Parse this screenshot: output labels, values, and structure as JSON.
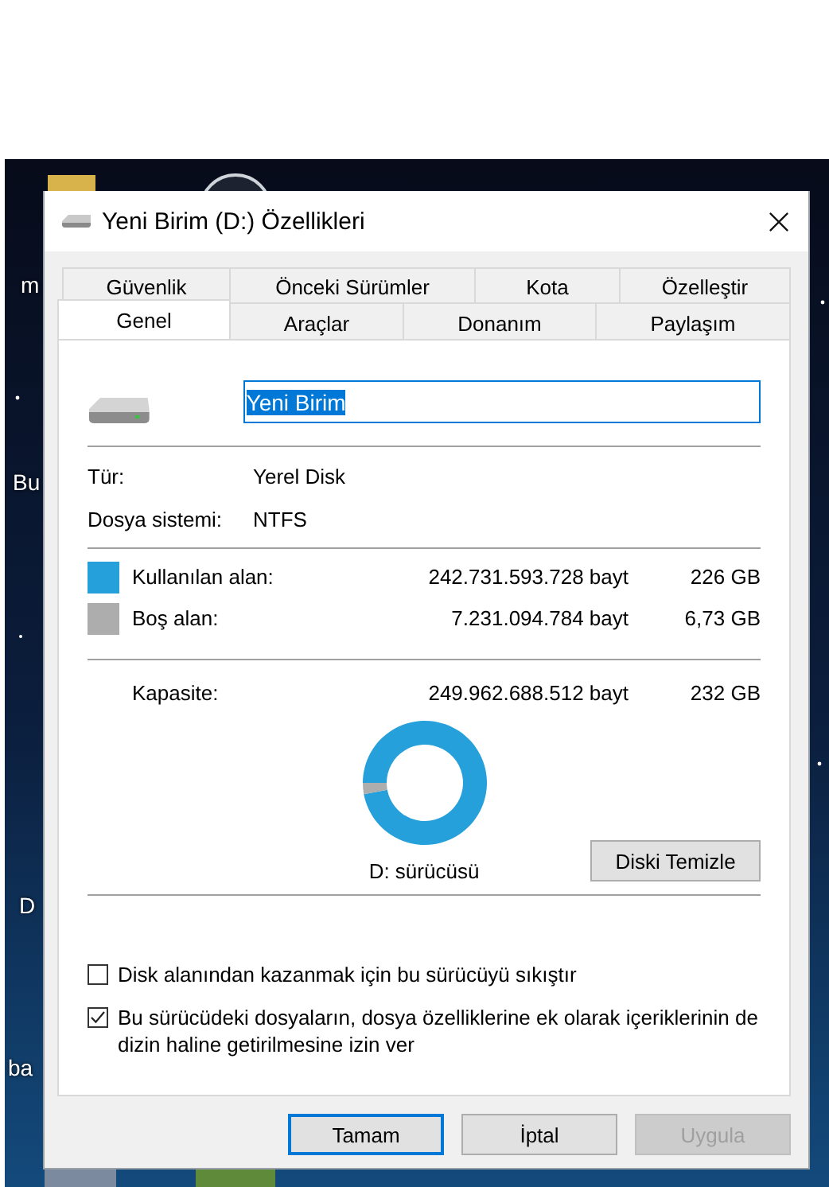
{
  "desktop_labels": [
    "m",
    "Bu",
    "D",
    "ba"
  ],
  "window": {
    "title": "Yeni Birim (D:) Özellikleri"
  },
  "tab_rows": [
    [
      {
        "label": "Güvenlik",
        "selected": false
      },
      {
        "label": "Önceki Sürümler",
        "selected": false
      },
      {
        "label": "Kota",
        "selected": false
      },
      {
        "label": "Özelleştir",
        "selected": false
      }
    ],
    [
      {
        "label": "Genel",
        "selected": true
      },
      {
        "label": "Araçlar",
        "selected": false
      },
      {
        "label": "Donanım",
        "selected": false
      },
      {
        "label": "Paylaşım",
        "selected": false
      }
    ]
  ],
  "name_field": {
    "value": "Yeni Birim",
    "text_selected": true
  },
  "info": [
    {
      "label": "Tür:",
      "value": "Yerel Disk"
    },
    {
      "label": "Dosya sistemi:",
      "value": "NTFS"
    }
  ],
  "usage": [
    {
      "label": "Kullanılan alan:",
      "bytes": "242.731.593.728 bayt",
      "size": "226 GB",
      "color": "#26a0da"
    },
    {
      "label": "Boş alan:",
      "bytes": "7.231.094.784 bayt",
      "size": "6,73 GB",
      "color": "#adadad"
    }
  ],
  "capacity": {
    "label": "Kapasite:",
    "bytes": "249.962.688.512 bayt",
    "size": "232 GB"
  },
  "drive_chart": {
    "label": "D: sürücüsü"
  },
  "cleanup_button": "Diski Temizle",
  "options": [
    {
      "label": "Disk alanından kazanmak için bu sürücüyü sıkıştır",
      "checked": false
    },
    {
      "label": "Bu sürücüdeki dosyaların, dosya özelliklerine ek olarak içeriklerinin de dizin haline getirilmesine izin ver",
      "checked": true
    }
  ],
  "buttons": [
    {
      "label": "Tamam",
      "default": true,
      "disabled": false
    },
    {
      "label": "İptal",
      "default": false,
      "disabled": false
    },
    {
      "label": "Uygula",
      "default": false,
      "disabled": true
    }
  ]
}
